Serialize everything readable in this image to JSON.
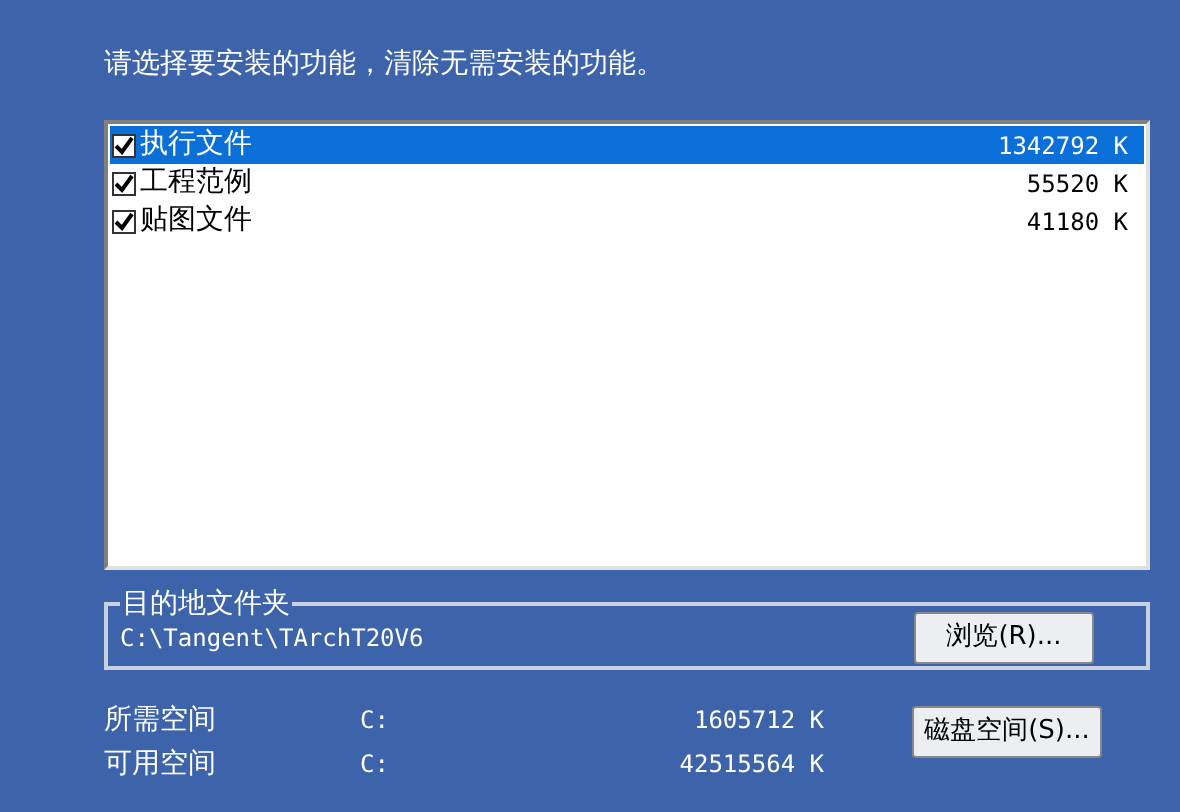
{
  "instruction": "请选择要安装的功能，清除无需安装的功能。",
  "features": [
    {
      "name": "执行文件",
      "size": "1342792 K",
      "checked": true,
      "selected": true
    },
    {
      "name": "工程范例",
      "size": "55520 K",
      "checked": true,
      "selected": false
    },
    {
      "name": "贴图文件",
      "size": "41180 K",
      "checked": true,
      "selected": false
    }
  ],
  "destination": {
    "legend": "目的地文件夹",
    "path": "C:\\Tangent\\TArchT20V6",
    "button": "浏览(R)..."
  },
  "space": [
    {
      "label": "所需空间",
      "drive": "C:",
      "amount": "1605712 K"
    },
    {
      "label": "可用空间",
      "drive": "C:",
      "amount": "42515564 K"
    }
  ],
  "disk_button": "磁盘空间(S)..."
}
